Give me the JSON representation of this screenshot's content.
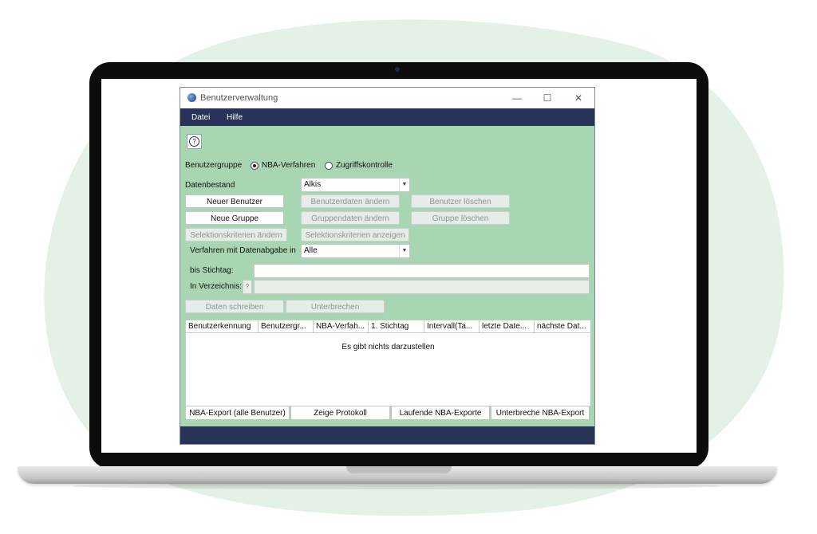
{
  "window": {
    "title": "Benutzerverwaltung",
    "controls": {
      "minimize": "—",
      "maximize": "☐",
      "close": "✕"
    }
  },
  "menu": {
    "items": [
      "Datei",
      "Hilfe"
    ]
  },
  "help_button": {
    "symbol": "?"
  },
  "benutzergruppe": {
    "label": "Benutzergruppe",
    "options": [
      {
        "label": "NBA-Verfahren",
        "selected": true
      },
      {
        "label": "Zugriffskontrolle",
        "selected": false
      }
    ]
  },
  "datenbestand": {
    "label": "Datenbestand",
    "value": "Alkis"
  },
  "buttons": {
    "neuer_benutzer": "Neuer Benutzer",
    "benutzerdaten_aendern": "Benutzerdaten ändern",
    "benutzer_loeschen": "Benutzer löschen",
    "neue_gruppe": "Neue Gruppe",
    "gruppendaten_aendern": "Gruppendaten ändern",
    "gruppe_loeschen": "Gruppe löschen",
    "selektionskriterien_aendern": "Selektionskriterien ändern",
    "selektionskriterien_anzeigen": "Selektionskriterien anzeigen",
    "daten_schreiben": "Daten schreiben",
    "unterbrechen": "Unterbrechen"
  },
  "verfahren": {
    "label": "Verfahren mit Datenabgabe in",
    "value": "Alle"
  },
  "stichtag": {
    "label": "bis Stichtag:",
    "value": ""
  },
  "verzeichnis": {
    "label": "In Verzeichnis:",
    "button": "?",
    "value": ""
  },
  "table": {
    "columns": [
      "Benutzerkennung",
      "Benutzergr...",
      "NBA-Verfah...",
      "1. Stichtag",
      "Intervall(Ta...",
      "letzte Date...",
      "nächste Dat..."
    ],
    "empty_message": "Es gibt nichts darzustellen"
  },
  "bottom_buttons": {
    "nba_export_alle": "NBA-Export (alle Benutzer)",
    "zeige_protokoll": "Zeige Protokoll",
    "laufende_exporte": "Laufende NBA-Exporte",
    "unterbreche_export": "Unterbreche NBA-Export"
  },
  "colors": {
    "window_bg": "#a9d6b2",
    "menubar": "#283359",
    "blob": "#e3f1e6"
  }
}
